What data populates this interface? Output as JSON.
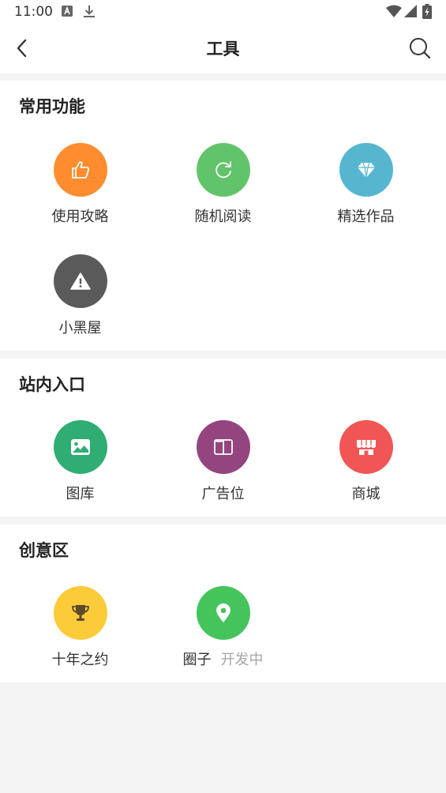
{
  "status_bar": {
    "time": "11:00",
    "icons": [
      "a-badge-icon",
      "download-icon",
      "wifi-icon",
      "signal-icon",
      "battery-charging-icon"
    ]
  },
  "app_bar": {
    "title": "工具",
    "back_icon": "chevron-left-icon",
    "search_icon": "search-icon"
  },
  "sections": [
    {
      "title": "常用功能",
      "items": [
        {
          "label": "使用攻略",
          "icon": "thumbs-up-icon",
          "color": "#ff8c2f"
        },
        {
          "label": "随机阅读",
          "icon": "refresh-icon",
          "color": "#62c46a"
        },
        {
          "label": "精选作品",
          "icon": "diamond-icon",
          "color": "#56b6cf"
        },
        {
          "label": "小黑屋",
          "icon": "warning-icon",
          "color": "#5a5a5a"
        }
      ]
    },
    {
      "title": "站内入口",
      "items": [
        {
          "label": "图库",
          "icon": "image-icon",
          "color": "#2fad72"
        },
        {
          "label": "广告位",
          "icon": "book-open-icon",
          "color": "#94457f"
        },
        {
          "label": "商城",
          "icon": "store-icon",
          "color": "#f25555"
        }
      ]
    },
    {
      "title": "创意区",
      "items": [
        {
          "label": "十年之约",
          "icon": "trophy-icon",
          "color": "#fccb3a"
        },
        {
          "label": "圈子",
          "extra": "开发中",
          "icon": "location-pin-icon",
          "color": "#45c45c"
        }
      ]
    }
  ]
}
